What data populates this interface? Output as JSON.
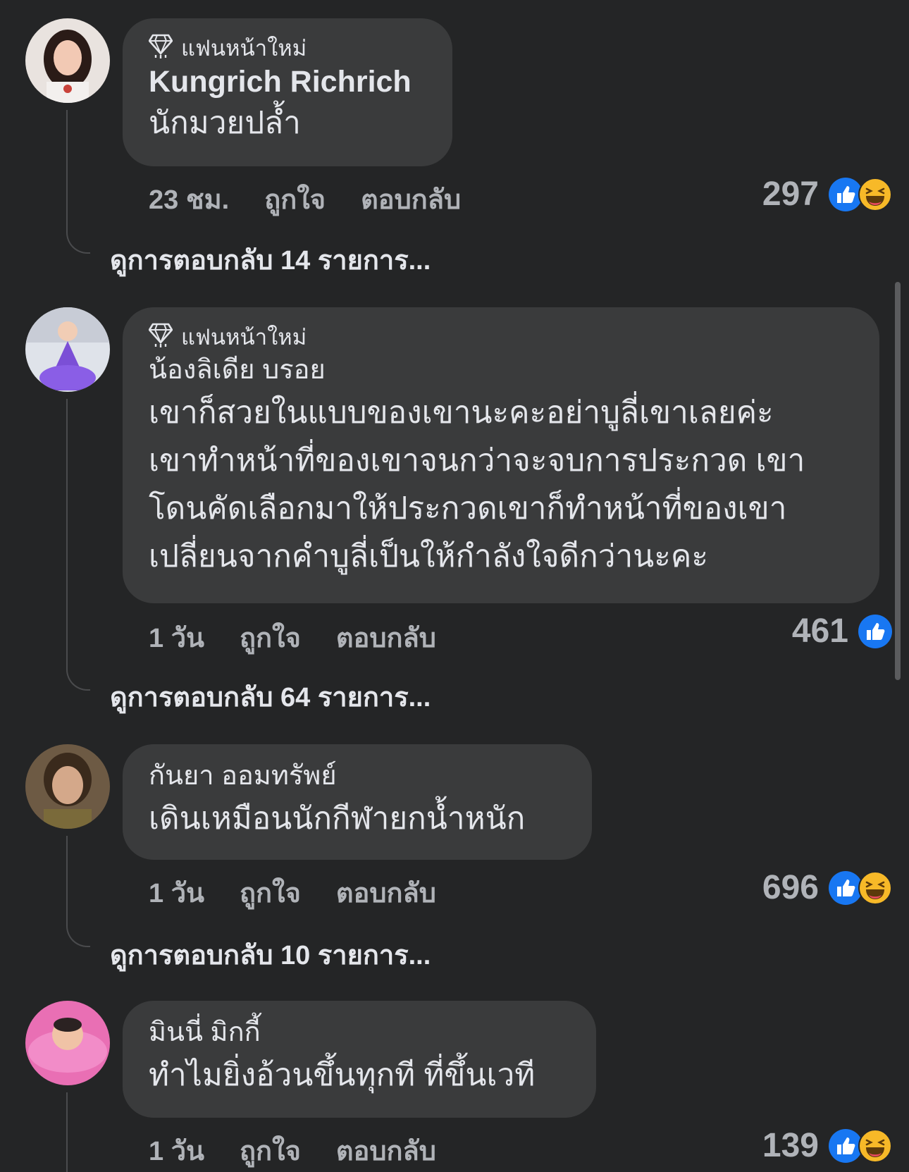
{
  "comments": [
    {
      "badge": "แฟนหน้าใหม่",
      "author": "Kungrich Richrich",
      "text": "นักมวยปล้ำ",
      "time": "23 ชม.",
      "like_label": "ถูกใจ",
      "reply_label": "ตอบกลับ",
      "reaction_count": "297",
      "reactions": [
        "like-icon",
        "haha-icon"
      ],
      "view_replies": "ดูการตอบกลับ 14 รายการ..."
    },
    {
      "badge": "แฟนหน้าใหม่",
      "author": "น้องลิเดีย บรอย",
      "text_lines": [
        "เขาก็สวยในแบบของเขานะคะอย่าบูลี่เขาเลยค่ะ",
        "เขาทำหน้าที่ของเขาจนกว่าจะจบการประกวด เขา",
        "โดนคัดเลือกมาให้ประกวดเขาก็ทำหน้าที่ของเขา",
        "เปลี่ยนจากคำบูลี่เป็นให้กำลังใจดีกว่านะคะ"
      ],
      "time": "1 วัน",
      "like_label": "ถูกใจ",
      "reply_label": "ตอบกลับ",
      "reaction_count": "461",
      "reactions": [
        "like-icon"
      ],
      "view_replies": "ดูการตอบกลับ 64 รายการ..."
    },
    {
      "author": "กันยา ออมทรัพย์",
      "text": "เดินเหมือนนักกีฬายกน้ำหนัก",
      "time": "1 วัน",
      "like_label": "ถูกใจ",
      "reply_label": "ตอบกลับ",
      "reaction_count": "696",
      "reactions": [
        "like-icon",
        "haha-icon"
      ],
      "view_replies": "ดูการตอบกลับ 10 รายการ..."
    },
    {
      "author": "มินนี่ มิกกี้",
      "text": "ทำไมยิ่งอ้วนขึ้นทุกที ที่ขึ้นเวที",
      "time": "1 วัน",
      "like_label": "ถูกใจ",
      "reply_label": "ตอบกลับ",
      "reaction_count": "139",
      "reactions": [
        "like-icon",
        "haha-icon"
      ]
    }
  ],
  "colors": {
    "background": "#242526",
    "bubble": "#3a3b3c",
    "like_blue": "#1877f2",
    "haha_yellow": "#f7b928",
    "muted_text": "#b0b3b8"
  }
}
